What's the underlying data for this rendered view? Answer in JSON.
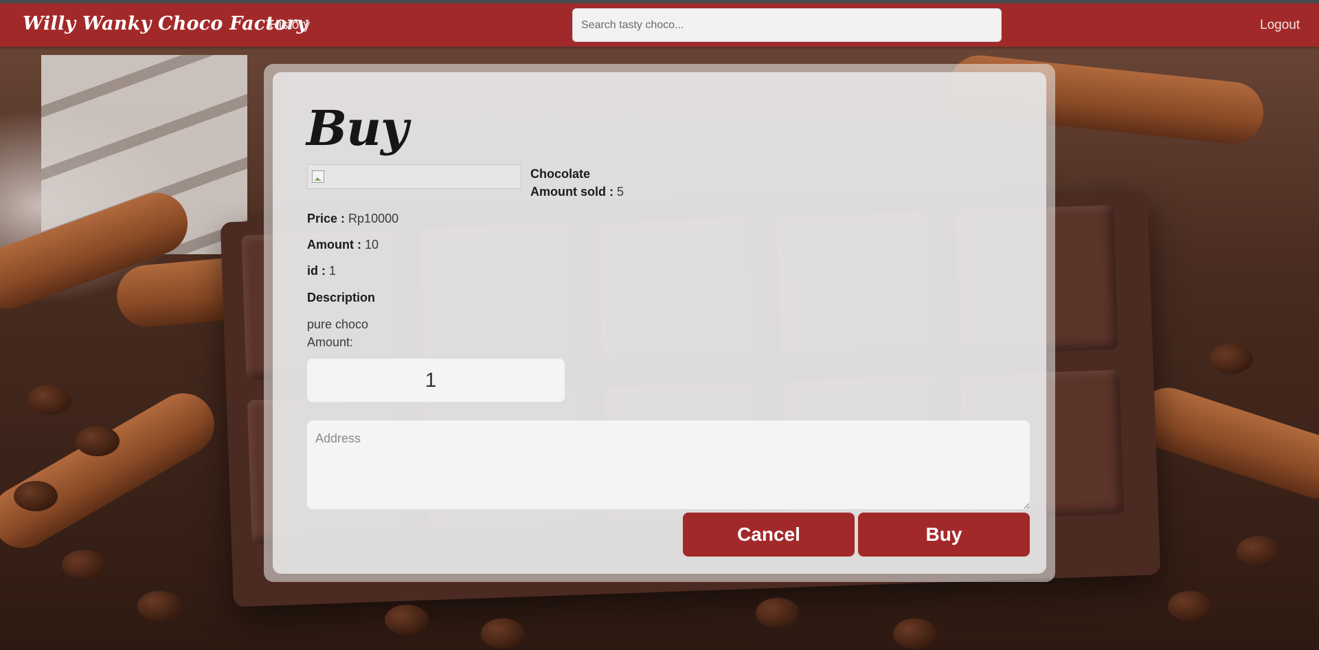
{
  "navbar": {
    "brand": "Willy Wanky Choco Factory",
    "history_label": "History",
    "search_placeholder": "Search tasty choco...",
    "logout_label": "Logout",
    "color": "#a2292a"
  },
  "modal": {
    "title": "Buy",
    "product": {
      "image_icon": "broken-image-icon",
      "name": "Chocolate",
      "amount_sold_label": "Amount sold :",
      "amount_sold_value": "5",
      "price_label": "Price :",
      "price_value": "Rp10000",
      "amount_label": "Amount :",
      "amount_value": "10",
      "id_label": "id :",
      "id_value": "1",
      "description_label": "Description",
      "description_value": "pure choco"
    },
    "form": {
      "amount_label": "Amount:",
      "amount_value": "1",
      "address_placeholder": "Address",
      "cancel_label": "Cancel",
      "buy_label": "Buy"
    }
  }
}
